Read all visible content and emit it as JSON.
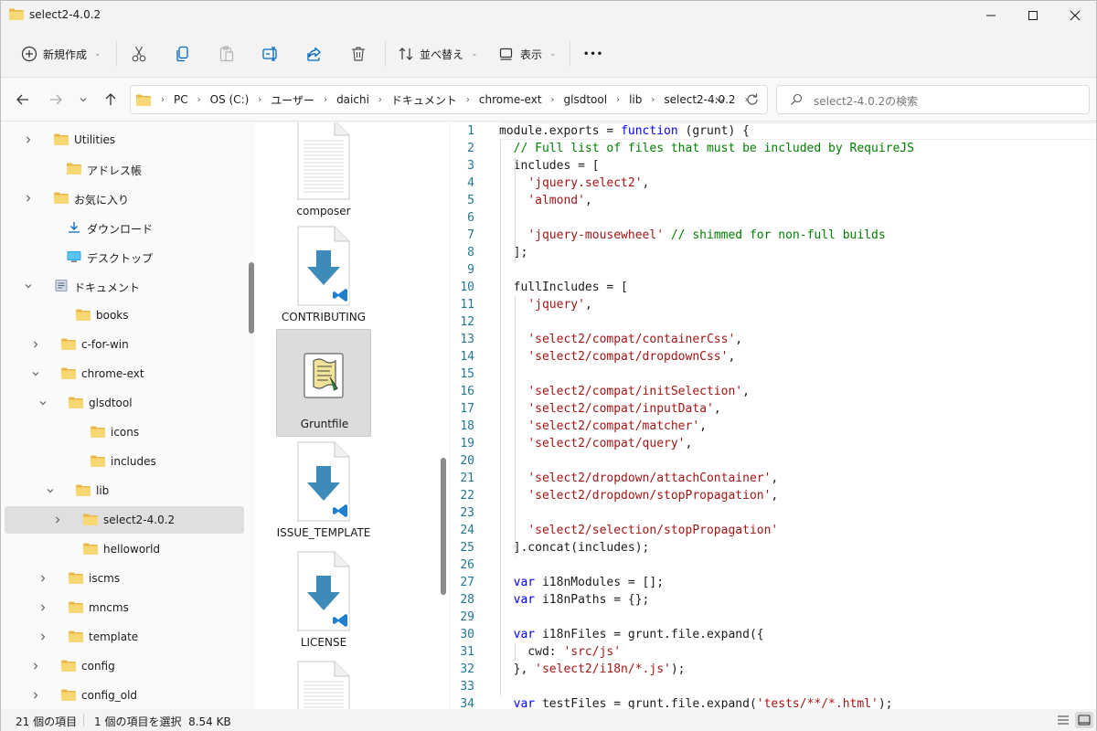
{
  "window": {
    "title": "select2-4.0.2"
  },
  "command_bar": {
    "new_label": "新規作成",
    "sort_label": "並べ替え",
    "view_label": "表示",
    "more_label": "•••"
  },
  "address": {
    "crumbs": [
      "PC",
      "OS (C:)",
      "ユーザー",
      "daichi",
      "ドキュメント",
      "chrome-ext",
      "glsdtool",
      "lib",
      "select2-4.0.2"
    ]
  },
  "search": {
    "placeholder": "select2-4.0.2の検索"
  },
  "tree": {
    "items": [
      {
        "label": "Utilities",
        "icon": "folder-icon",
        "chevron": "right"
      },
      {
        "label": "アドレス帳",
        "icon": "folder-icon",
        "chevron": ""
      },
      {
        "label": "お気に入り",
        "icon": "folder-icon",
        "chevron": "right"
      },
      {
        "label": "ダウンロード",
        "icon": "download-icon",
        "chevron": ""
      },
      {
        "label": "デスクトップ",
        "icon": "desktop-icon",
        "chevron": ""
      },
      {
        "label": "ドキュメント",
        "icon": "documents-icon",
        "chevron": "down"
      },
      {
        "label": "books",
        "icon": "folder-icon",
        "chevron": ""
      },
      {
        "label": "c-for-win",
        "icon": "folder-icon",
        "chevron": "right"
      },
      {
        "label": "chrome-ext",
        "icon": "folder-icon",
        "chevron": "down"
      },
      {
        "label": "glsdtool",
        "icon": "folder-icon",
        "chevron": "down"
      },
      {
        "label": "icons",
        "icon": "folder-icon",
        "chevron": ""
      },
      {
        "label": "includes",
        "icon": "folder-icon",
        "chevron": ""
      },
      {
        "label": "lib",
        "icon": "folder-icon",
        "chevron": "down"
      },
      {
        "label": "select2-4.0.2",
        "icon": "folder-icon",
        "chevron": "right",
        "selected": true
      },
      {
        "label": "helloworld",
        "icon": "folder-icon",
        "chevron": ""
      },
      {
        "label": "iscms",
        "icon": "folder-icon",
        "chevron": "right"
      },
      {
        "label": "mncms",
        "icon": "folder-icon",
        "chevron": "right"
      },
      {
        "label": "template",
        "icon": "folder-icon",
        "chevron": "right"
      },
      {
        "label": "config",
        "icon": "folder-icon",
        "chevron": "right"
      },
      {
        "label": "config_old",
        "icon": "folder-icon",
        "chevron": "right"
      }
    ]
  },
  "files": {
    "items": [
      {
        "label": "composer",
        "icon": "text-file-icon"
      },
      {
        "label": "CONTRIBUTING",
        "icon": "vscode-file-icon"
      },
      {
        "label": "Gruntfile",
        "icon": "script-file-icon",
        "selected": true
      },
      {
        "label": "ISSUE_TEMPLATE",
        "icon": "vscode-file-icon"
      },
      {
        "label": "LICENSE",
        "icon": "vscode-file-icon"
      },
      {
        "label": "",
        "icon": "text-file-icon"
      }
    ]
  },
  "preview": {
    "lines": [
      {
        "n": "1",
        "code": "module.exports = function (grunt) {"
      },
      {
        "n": "2",
        "code": "  // Full list of files that must be included by RequireJS"
      },
      {
        "n": "3",
        "code": "  includes = ["
      },
      {
        "n": "4",
        "code": "    'jquery.select2',"
      },
      {
        "n": "5",
        "code": "    'almond',"
      },
      {
        "n": "6",
        "code": ""
      },
      {
        "n": "7",
        "code": "    'jquery-mousewheel' // shimmed for non-full builds"
      },
      {
        "n": "8",
        "code": "  ];"
      },
      {
        "n": "9",
        "code": ""
      },
      {
        "n": "10",
        "code": "  fullIncludes = ["
      },
      {
        "n": "11",
        "code": "    'jquery',"
      },
      {
        "n": "12",
        "code": ""
      },
      {
        "n": "13",
        "code": "    'select2/compat/containerCss',"
      },
      {
        "n": "14",
        "code": "    'select2/compat/dropdownCss',"
      },
      {
        "n": "15",
        "code": ""
      },
      {
        "n": "16",
        "code": "    'select2/compat/initSelection',"
      },
      {
        "n": "17",
        "code": "    'select2/compat/inputData',"
      },
      {
        "n": "18",
        "code": "    'select2/compat/matcher',"
      },
      {
        "n": "19",
        "code": "    'select2/compat/query',"
      },
      {
        "n": "20",
        "code": ""
      },
      {
        "n": "21",
        "code": "    'select2/dropdown/attachContainer',"
      },
      {
        "n": "22",
        "code": "    'select2/dropdown/stopPropagation',"
      },
      {
        "n": "23",
        "code": ""
      },
      {
        "n": "24",
        "code": "    'select2/selection/stopPropagation'"
      },
      {
        "n": "25",
        "code": "  ].concat(includes);"
      },
      {
        "n": "26",
        "code": ""
      },
      {
        "n": "27",
        "code": "  var i18nModules = [];"
      },
      {
        "n": "28",
        "code": "  var i18nPaths = {};"
      },
      {
        "n": "29",
        "code": ""
      },
      {
        "n": "30",
        "code": "  var i18nFiles = grunt.file.expand({"
      },
      {
        "n": "31",
        "code": "    cwd: 'src/js'"
      },
      {
        "n": "32",
        "code": "  }, 'select2/i18n/*.js');"
      },
      {
        "n": "33",
        "code": ""
      },
      {
        "n": "34",
        "code": "  var testFiles = grunt.file.expand('tests/**/*.html');"
      }
    ]
  },
  "status": {
    "item_count": "21 個の項目",
    "selection": "1 個の項目を選択  8.54 KB"
  },
  "colors": {
    "accent": "#0067c0",
    "folder": "#f8d775",
    "keyword": "#0000ff",
    "string": "#a31515",
    "comment": "#008000",
    "line_number": "#237893"
  }
}
